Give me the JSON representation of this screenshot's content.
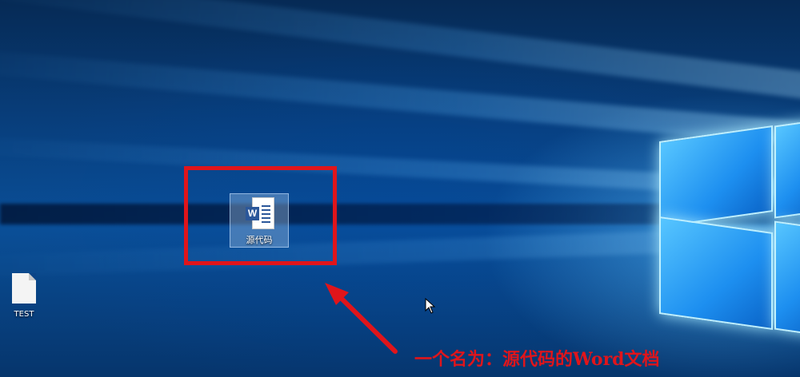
{
  "desktop": {
    "icons": [
      {
        "label": "源代码",
        "type": "word-document",
        "selected": true
      },
      {
        "label": "TEST",
        "type": "blank-document",
        "selected": false
      }
    ]
  },
  "annotation": {
    "caption": "一个名为：源代码的Word文档",
    "highlight_color": "#e0151b"
  },
  "icons": {
    "word_badge": "W"
  }
}
